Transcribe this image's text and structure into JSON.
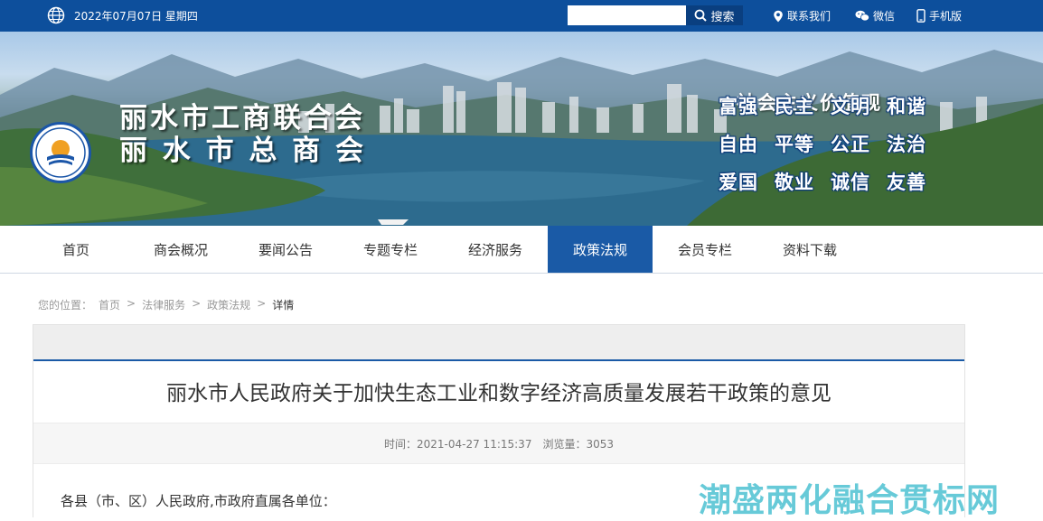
{
  "topbar": {
    "date": "2022年07月07日 星期四",
    "search": {
      "placeholder": "",
      "button_label": "搜索"
    },
    "links": [
      {
        "label": "联系我们",
        "icon": "location-pin-icon"
      },
      {
        "label": "微信",
        "icon": "wechat-icon"
      },
      {
        "label": "手机版",
        "icon": "mobile-phone-icon"
      }
    ]
  },
  "banner": {
    "org_name_line1": "丽水市工商联合会",
    "org_name_line2": "丽 水 市 总 商 会",
    "values_title": "社会主义价值观",
    "values_rows": [
      [
        "富强",
        "民主",
        "文明",
        "和谐"
      ],
      [
        "自由",
        "平等",
        "公正",
        "法治"
      ],
      [
        "爱国",
        "敬业",
        "诚信",
        "友善"
      ]
    ]
  },
  "nav": {
    "items": [
      "首页",
      "商会概况",
      "要闻公告",
      "专题专栏",
      "经济服务",
      "政策法规",
      "会员专栏",
      "资料下载"
    ],
    "active": "政策法规"
  },
  "breadcrumb": {
    "prefix": "您的位置：",
    "items": [
      "首页",
      "法律服务",
      "政策法规"
    ],
    "current": "详情",
    "separator": ">"
  },
  "article": {
    "title": "丽水市人民政府关于加快生态工业和数字经济高质量发展若干政策的意见",
    "time_label": "时间：",
    "time": "2021-04-27 11:15:37",
    "views_label": "浏览量：",
    "views": "3053",
    "body_first_line": "各县（市、区）人民政府,市政府直属各单位："
  },
  "watermark": "潮盛两化融合贯标网",
  "colors": {
    "topbar": "#0d4f9c",
    "nav_active": "#1a5aa6",
    "watermark": "#27b4c8"
  }
}
